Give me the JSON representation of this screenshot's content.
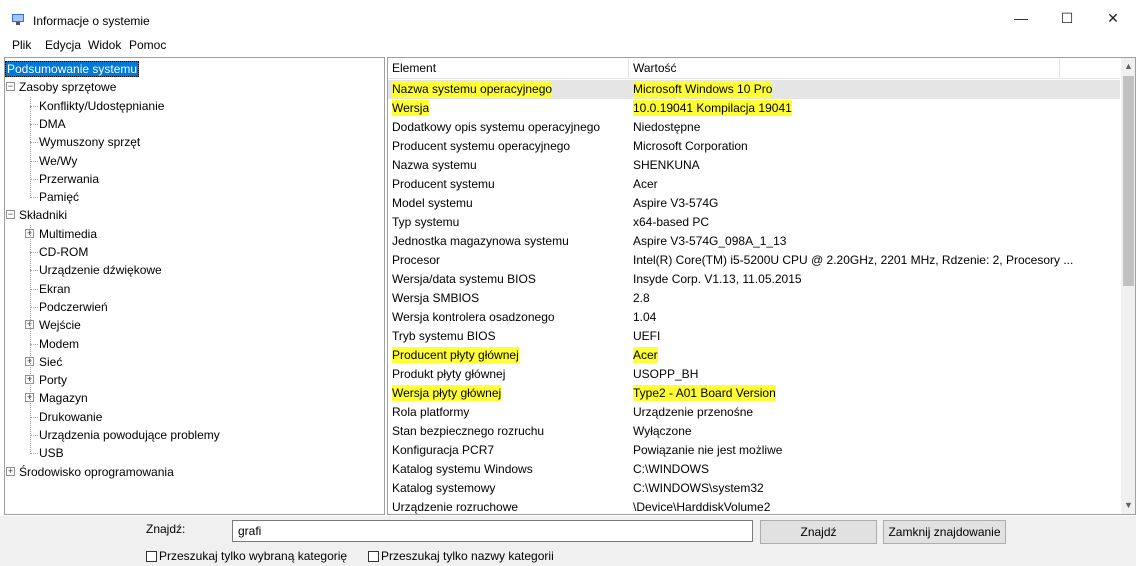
{
  "window": {
    "title": "Informacje o systemie",
    "minimize_glyph": "—",
    "maximize_glyph": "☐",
    "close_glyph": "✕"
  },
  "menu": [
    "Plik",
    "Edycja",
    "Widok",
    "Pomoc"
  ],
  "tree": [
    {
      "label": "Podsumowanie systemu",
      "level": 0,
      "expander": "",
      "selected": true
    },
    {
      "label": "Zasoby sprzętowe",
      "level": 0,
      "expander": "−"
    },
    {
      "label": "Konflikty/Udostępnianie",
      "level": 1
    },
    {
      "label": "DMA",
      "level": 1
    },
    {
      "label": "Wymuszony sprzęt",
      "level": 1
    },
    {
      "label": "We/Wy",
      "level": 1
    },
    {
      "label": "Przerwania",
      "level": 1
    },
    {
      "label": "Pamięć",
      "level": 1
    },
    {
      "label": "Składniki",
      "level": 0,
      "expander": "−"
    },
    {
      "label": "Multimedia",
      "level": 1,
      "expander": "+"
    },
    {
      "label": "CD-ROM",
      "level": 1
    },
    {
      "label": "Urządzenie dźwiękowe",
      "level": 1
    },
    {
      "label": "Ekran",
      "level": 1
    },
    {
      "label": "Podczerwień",
      "level": 1
    },
    {
      "label": "Wejście",
      "level": 1,
      "expander": "+"
    },
    {
      "label": "Modem",
      "level": 1
    },
    {
      "label": "Sieć",
      "level": 1,
      "expander": "+"
    },
    {
      "label": "Porty",
      "level": 1,
      "expander": "+"
    },
    {
      "label": "Magazyn",
      "level": 1,
      "expander": "+"
    },
    {
      "label": "Drukowanie",
      "level": 1
    },
    {
      "label": "Urządzenia powodujące problemy",
      "level": 1
    },
    {
      "label": "USB",
      "level": 1
    },
    {
      "label": "Środowisko oprogramowania",
      "level": 0,
      "expander": "+"
    }
  ],
  "list": {
    "headers": [
      "Element",
      "Wartość"
    ],
    "rows": [
      {
        "element": "Nazwa systemu operacyjnego",
        "value": "Microsoft Windows 10 Pro",
        "highlight_element": true,
        "highlight_value": true
      },
      {
        "element": "Wersja",
        "value": "10.0.19041 Kompilacja 19041",
        "highlight_element": true,
        "highlight_value": true
      },
      {
        "element": "Dodatkowy opis systemu operacyjnego",
        "value": "Niedostępne"
      },
      {
        "element": "Producent systemu operacyjnego",
        "value": "Microsoft Corporation"
      },
      {
        "element": "Nazwa systemu",
        "value": "SHENKUNA"
      },
      {
        "element": "Producent systemu",
        "value": "Acer"
      },
      {
        "element": "Model systemu",
        "value": "Aspire V3-574G"
      },
      {
        "element": "Typ systemu",
        "value": "x64-based PC"
      },
      {
        "element": "Jednostka magazynowa systemu",
        "value": "Aspire V3-574G_098A_1_13"
      },
      {
        "element": "Procesor",
        "value": "Intel(R) Core(TM) i5-5200U CPU @ 2.20GHz, 2201 MHz, Rdzenie: 2, Procesory ..."
      },
      {
        "element": "Wersja/data systemu BIOS",
        "value": "Insyde Corp. V1.13, 11.05.2015"
      },
      {
        "element": "Wersja SMBIOS",
        "value": "2.8"
      },
      {
        "element": "Wersja kontrolera osadzonego",
        "value": "1.04"
      },
      {
        "element": "Tryb systemu BIOS",
        "value": "UEFI"
      },
      {
        "element": "Producent płyty głównej",
        "value": "Acer",
        "highlight_element": true,
        "highlight_value": true
      },
      {
        "element": "Produkt płyty głównej",
        "value": "USOPP_BH"
      },
      {
        "element": "Wersja płyty głównej",
        "value": "Type2 - A01 Board Version",
        "highlight_element": true,
        "highlight_value": true
      },
      {
        "element": "Rola platformy",
        "value": "Urządzenie przenośne"
      },
      {
        "element": "Stan bezpiecznego rozruchu",
        "value": "Wyłączone"
      },
      {
        "element": "Konfiguracja PCR7",
        "value": "Powiązanie nie jest możliwe"
      },
      {
        "element": "Katalog systemu Windows",
        "value": "C:\\WINDOWS"
      },
      {
        "element": "Katalog systemowy",
        "value": "C:\\WINDOWS\\system32"
      },
      {
        "element": "Urządzenie rozruchowe",
        "value": "\\Device\\HarddiskVolume2"
      }
    ]
  },
  "find": {
    "label": "Znajdź:",
    "value": "grafi",
    "find_button": "Znajdź",
    "close_find_button": "Zamknij znajdowanie",
    "checkbox_selected_category": "Przeszukaj tylko wybraną kategorię",
    "checkbox_category_names": "Przeszukaj tylko nazwy kategorii"
  },
  "colors": {
    "highlight": "#ffff33",
    "selection": "#0078d7"
  }
}
